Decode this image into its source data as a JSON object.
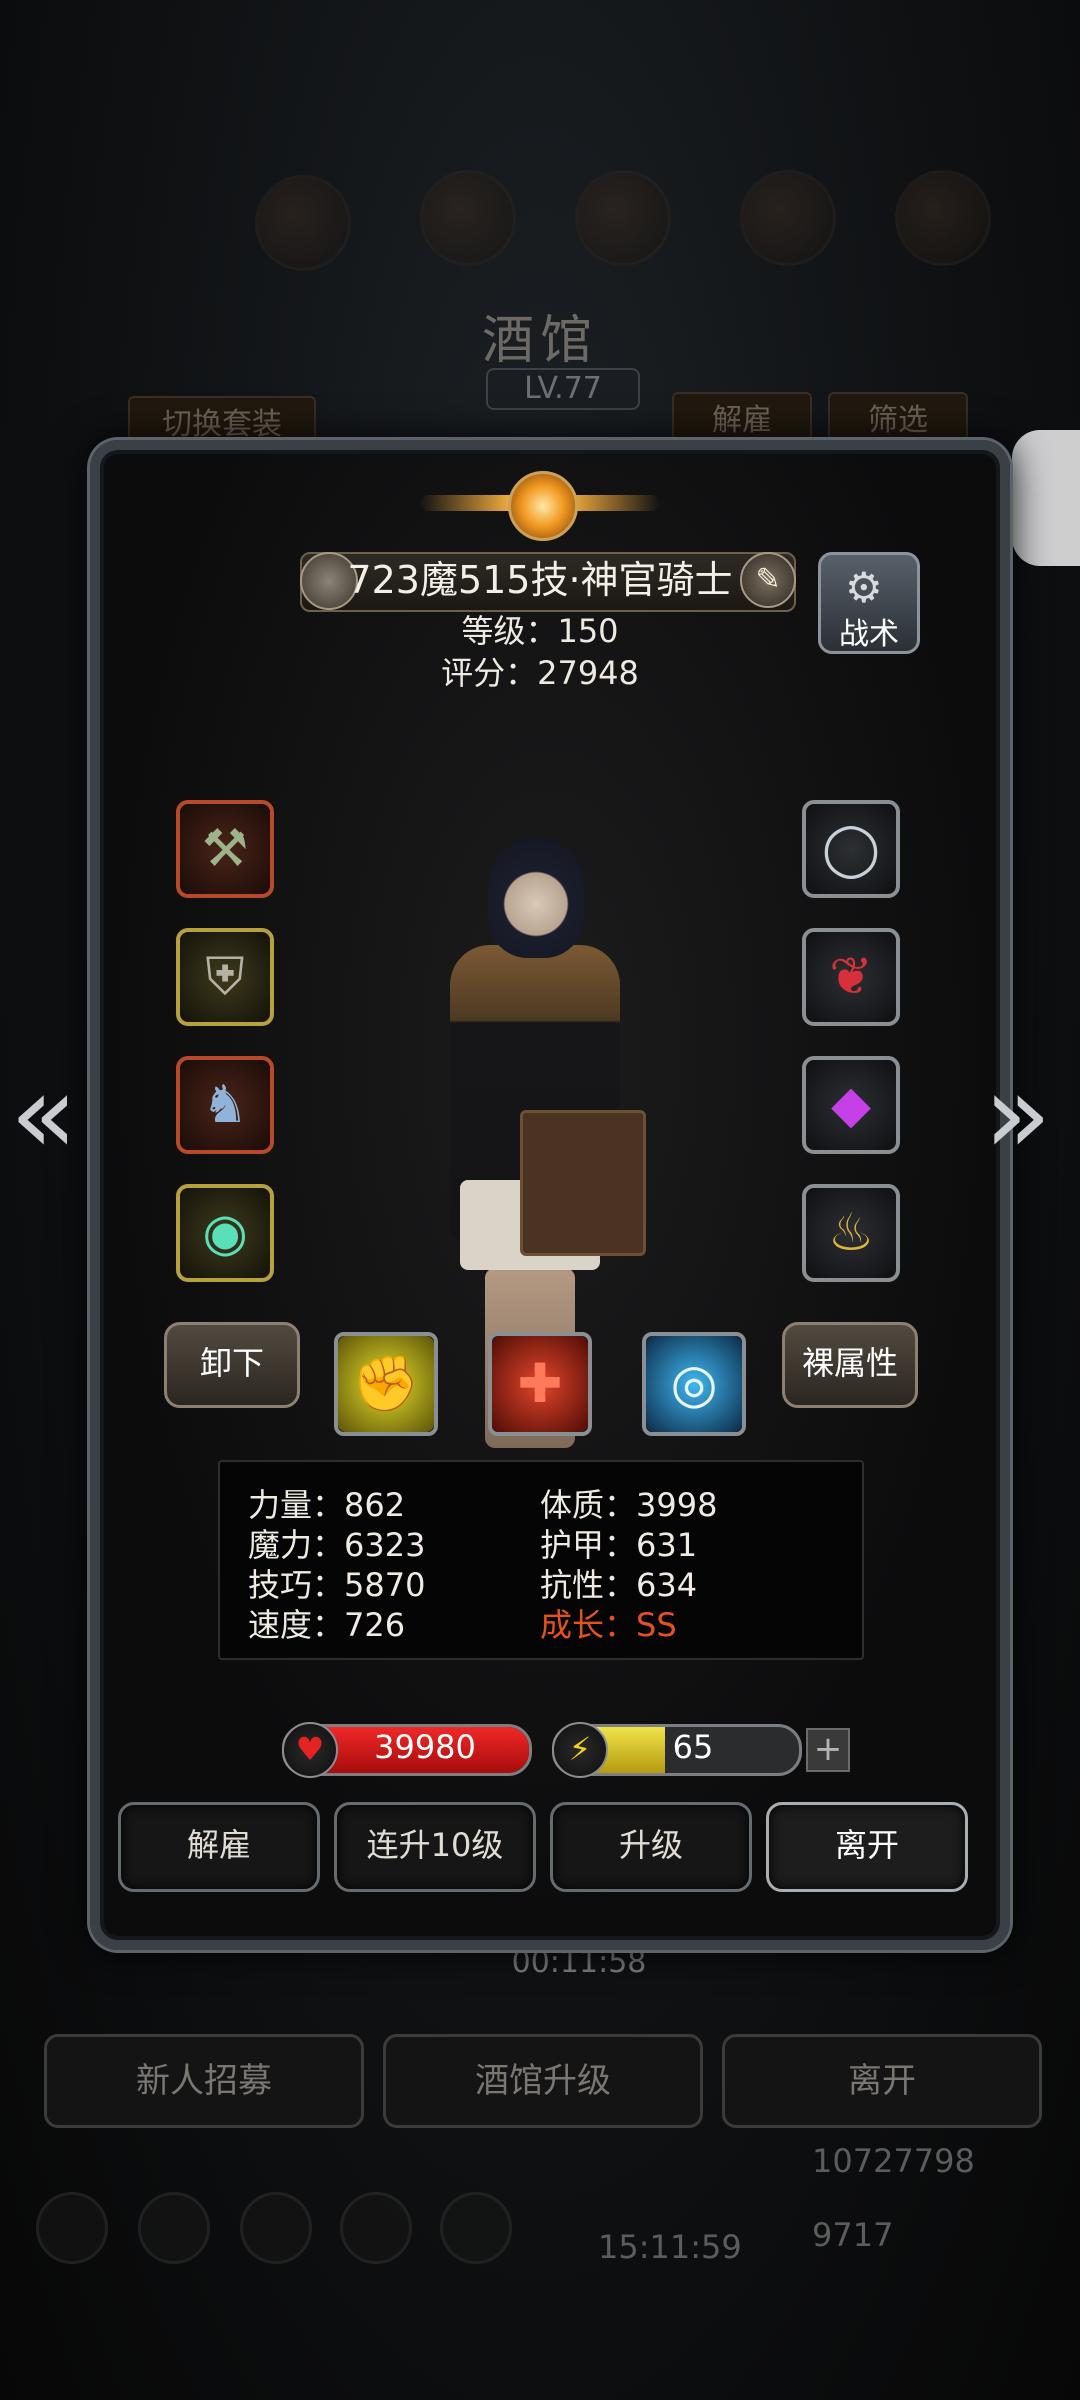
{
  "background": {
    "title": "酒馆",
    "level": "LV.77",
    "switch_outfit": "切换套装",
    "dismiss": "解雇",
    "filter": "筛选",
    "timer": "00:11:58",
    "bottom_buttons": [
      "新人招募",
      "酒馆升级",
      "离开"
    ],
    "currency_gold": "10727798",
    "currency_gem": "9717",
    "clock": "15:11:59"
  },
  "hero": {
    "name": "723魔515技·神官骑士",
    "level_line": "等级：150",
    "score_line": "评分：27948",
    "tactics_label": "战术"
  },
  "equip_left": [
    "axe-icon",
    "armor-icon",
    "helmet-icon",
    "ring-icon"
  ],
  "equip_right": [
    "bracelet-icon",
    "amulet-icon",
    "gem-icon",
    "lantern-icon"
  ],
  "actions": {
    "unequip": "卸下",
    "base_attr": "裸属性"
  },
  "skills": [
    "fist-skill-icon",
    "heal-skill-icon",
    "eye-skill-icon"
  ],
  "stats": {
    "strength": "力量：862",
    "magic": "魔力：6323",
    "skill": "技巧：5870",
    "speed": "速度：726",
    "constitution": "体质：3998",
    "armor": "护甲：631",
    "resist": "抗性：634",
    "growth": "成长：SS"
  },
  "hp": {
    "value": "39980",
    "fill": 1.0
  },
  "energy": {
    "value": "65",
    "fill": 0.45
  },
  "plus": "+",
  "buttons": {
    "dismiss": "解雇",
    "level10": "连升10级",
    "upgrade": "升级",
    "leave": "离开"
  },
  "colors": {
    "highlight": "#e6521e",
    "hp": "#e52323",
    "energy": "#f4d21d"
  }
}
